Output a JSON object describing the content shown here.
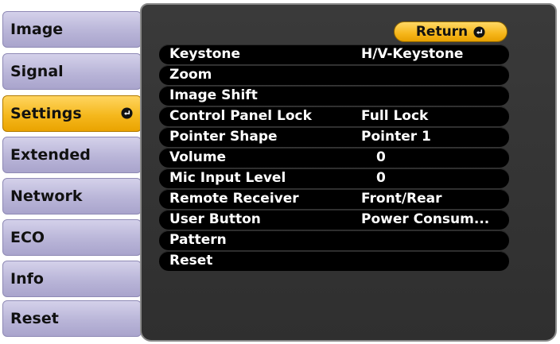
{
  "sidebar": {
    "items": [
      {
        "label": "Image"
      },
      {
        "label": "Signal"
      },
      {
        "label": "Settings"
      },
      {
        "label": "Extended"
      },
      {
        "label": "Network"
      },
      {
        "label": "ECO"
      },
      {
        "label": "Info"
      },
      {
        "label": "Reset"
      }
    ],
    "active_item": "Settings"
  },
  "main": {
    "return_label": "Return",
    "rows": [
      {
        "label": "Keystone",
        "value": "H/V-Keystone"
      },
      {
        "label": "Zoom",
        "value": ""
      },
      {
        "label": "Image Shift",
        "value": ""
      },
      {
        "label": "Control Panel Lock",
        "value": "Full Lock"
      },
      {
        "label": "Pointer Shape",
        "value": "Pointer 1"
      },
      {
        "label": "Volume",
        "value": "0"
      },
      {
        "label": "Mic Input Level",
        "value": "0"
      },
      {
        "label": "Remote Receiver",
        "value": "Front/Rear"
      },
      {
        "label": "User Button",
        "value": "Power Consum..."
      },
      {
        "label": "Pattern",
        "value": ""
      },
      {
        "label": "Reset",
        "value": ""
      }
    ]
  },
  "colors": {
    "sidebar_button": "#b9b5d8",
    "active_button": "#f5b81d",
    "panel_background": "#333333",
    "row_background": "#000000",
    "row_text": "#ffffff"
  },
  "icons": {
    "enter": "enter-icon"
  }
}
